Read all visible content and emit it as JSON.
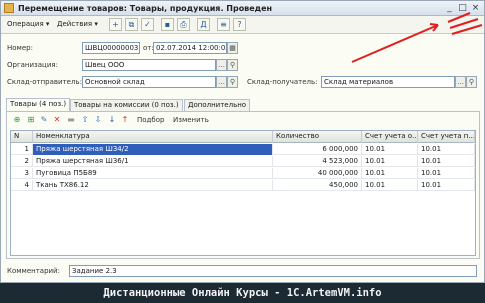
{
  "window": {
    "title": "Перемещение товаров: Товары, продукция. Проведен",
    "controls": [
      "_",
      "□",
      "×"
    ]
  },
  "toolbar": {
    "menu_operation": "Операция ▾",
    "menu_actions": "Действия ▾",
    "icons": [
      "new-icon",
      "copy-icon",
      "post-icon",
      "save-icon",
      "print-icon",
      "documents-icon",
      "structure-icon",
      "help-icon"
    ]
  },
  "header": {
    "number_label": "Номер:",
    "number_value": "ШВЦ00000003",
    "date_label": "от:",
    "date_value": "02.07.2014 12:00:02",
    "org_label": "Организация:",
    "org_value": "Швец ООО",
    "sender_label": "Склад-отправитель:",
    "sender_value": "Основной склад",
    "receiver_label": "Склад-получатель:",
    "receiver_value": "Склад материалов"
  },
  "tabs": [
    {
      "label": "Товары (4 поз.)"
    },
    {
      "label": "Товары на комиссии (0 поз.)"
    },
    {
      "label": "Дополнительно"
    }
  ],
  "table_toolbar": {
    "selection_label": "Подбор",
    "change_label": "Изменить"
  },
  "table": {
    "columns": [
      "N",
      "Номенклатура",
      "Количество",
      "Счет учета о...",
      "Счет учета п..."
    ],
    "rows": [
      {
        "n": "1",
        "name": "Пряжа шерстяная Ш34/2",
        "qty": "6 000,000",
        "acc_from": "10.01",
        "acc_to": "10.01"
      },
      {
        "n": "2",
        "name": "Пряжа шерстяная Ш36/1",
        "qty": "4 523,000",
        "acc_from": "10.01",
        "acc_to": "10.01"
      },
      {
        "n": "3",
        "name": "Пуговица П5Б89",
        "qty": "40 000,000",
        "acc_from": "10.01",
        "acc_to": "10.01"
      },
      {
        "n": "4",
        "name": "Ткань ТХ86.12",
        "qty": "450,000",
        "acc_from": "10.01",
        "acc_to": "10.01"
      }
    ]
  },
  "comment": {
    "label": "Комментарий:",
    "value": "Задание 2.3"
  },
  "banner": "Дистанционные Онлайн Курсы - 1C.ArtemVM.info",
  "colors": {
    "selection": "#2f5fb9",
    "annotation": "#e02020"
  }
}
